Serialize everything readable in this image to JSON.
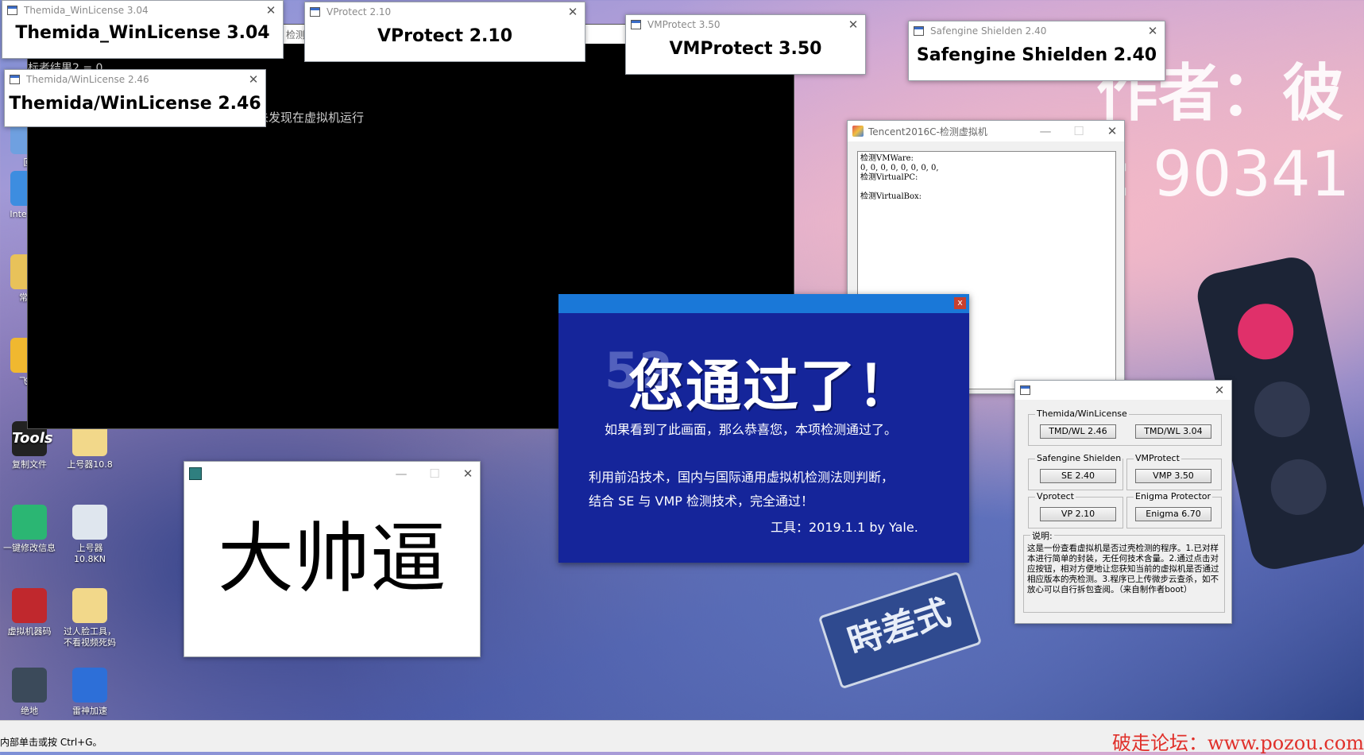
{
  "watermark_right": {
    "line1": "作者：彼",
    "line2": ": 90341"
  },
  "console": {
    "partial_line1": "检测工",
    "partial_line2": "标者结果2 = 0",
    "message": "未发现在虚拟机运行"
  },
  "windows": {
    "tmd304": {
      "title": "Themida_WinLicense 3.04",
      "body": "Themida_WinLicense 3.04"
    },
    "vp210": {
      "title": "VProtect 2.10",
      "body": "VProtect 2.10"
    },
    "vmp350": {
      "title": "VMProtect 3.50",
      "body": "VMProtect 3.50"
    },
    "se240": {
      "title": "Safengine Shielden 2.40",
      "body": "Safengine Shielden 2.40"
    },
    "tmd246": {
      "title": "Themida/WinLicense 2.46",
      "body": "Themida/WinLicense 2.46"
    }
  },
  "tencent": {
    "title": "Tencent2016C-检测虚拟机",
    "lines": [
      "检测VMWare:",
      "0, 0, 0, 0, 0, 0, 0, 0,",
      "检测VirtualPC:",
      "",
      "检测VirtualBox:"
    ]
  },
  "pass_dialog": {
    "close": "x",
    "headline": "您通过了！",
    "ghost": "52",
    "line1": "如果看到了此画面，那么恭喜您，本项检测通过了。",
    "line2": "利用前沿技术，国内与国际通用虚拟机检测法则判断，",
    "line3": "结合 SE 与 VMP 检测技术，完全通过！",
    "line4": "工具：2019.1.1  by Yale."
  },
  "dashuai": {
    "text": "大帅逼"
  },
  "tool_panel": {
    "groups": {
      "themida": {
        "label": "Themida/WinLicense",
        "btn1": "TMD/WL 2.46",
        "btn2": "TMD/WL 3.04"
      },
      "se": {
        "label": "Safengine Shielden",
        "btn": "SE 2.40"
      },
      "vmp": {
        "label": "VMProtect",
        "btn": "VMP 3.50"
      },
      "vprotect": {
        "label": "Vprotect",
        "btn": "VP 2.10"
      },
      "enigma": {
        "label": "Enigma Protector",
        "btn": "Enigma 6.70"
      }
    },
    "desc_label": "说明:",
    "desc": "这是一份查看虚拟机是否过壳检测的程序。1.已对样本进行简单的封装，无任何技术含量。2.通过点击对应按钮，相对方便地让您获知当前的虚拟机是否通过相应版本的壳检测。3.程序已上传微步云查杀，如不放心可以自行拆包查阅。（来自制作者boot）"
  },
  "desktop_icons": [
    {
      "label": "回",
      "color": "#6fa0e0"
    },
    {
      "label": "Inte Exp",
      "color": "#3d8de0"
    },
    {
      "label": "常用",
      "color": "#e8c25a"
    },
    {
      "label": "飞秋",
      "color": "#f0b830"
    },
    {
      "label": "复制文件",
      "glyph": "Tools",
      "color": "#222"
    },
    {
      "label": "上号器10.8",
      "color": "#f2d88a"
    },
    {
      "label": "一键修改信息",
      "color": "#2bb673"
    },
    {
      "label": "上号器 10.8KN",
      "color": "#dfe6ee"
    },
    {
      "label": "虚拟机器码",
      "color": "#c0282d"
    },
    {
      "label": "过人脸工具，不看视频死妈",
      "color": "#f2d88a"
    },
    {
      "label": "绝地",
      "color": "#3b4a5a"
    },
    {
      "label": "雷神加速",
      "color": "#2d6fd8"
    }
  ],
  "background_sign": "時差式",
  "statusbar": {
    "hint": "内部单击或按 Ctrl+G。",
    "forum": "破走论坛：www.pozou.com"
  }
}
